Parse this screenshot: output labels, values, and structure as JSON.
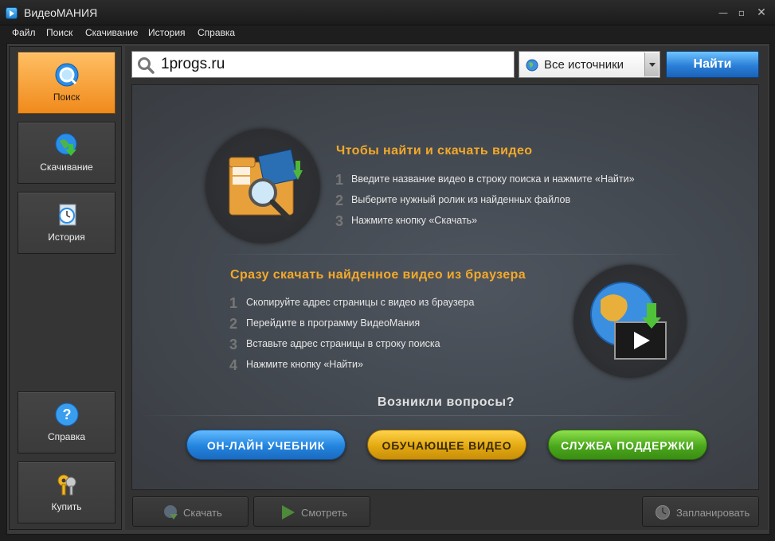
{
  "window": {
    "title": "ВидеоМАНИЯ"
  },
  "menu": [
    "Файл",
    "Поиск",
    "Скачивание",
    "История",
    "Справка"
  ],
  "sidebar": {
    "search": "Поиск",
    "download": "Скачивание",
    "history": "История",
    "help": "Справка",
    "buy": "Купить"
  },
  "search": {
    "value": "1progs.ru",
    "source": "Все источники",
    "button": "Найти"
  },
  "section1": {
    "title": "Чтобы найти и скачать видео",
    "steps": [
      "Введите название видео в строку поиска и нажмите «Найти»",
      "Выберите нужный ролик из найденных файлов",
      "Нажмите кнопку «Скачать»"
    ]
  },
  "section2": {
    "title": "Сразу скачать найденное видео из браузера",
    "steps": [
      "Скопируйте адрес страницы с видео из браузера",
      "Перейдите в программу ВидеоМания",
      "Вставьте адрес страницы в строку поиска",
      "Нажмите кнопку «Найти»"
    ]
  },
  "questions": {
    "title": "Возникли вопросы?",
    "online_tutorial": "ОН-ЛАЙН УЧЕБНИК",
    "training_video": "ОБУЧАЮЩЕЕ ВИДЕО",
    "support": "СЛУЖБА ПОДДЕРЖКИ"
  },
  "bottom": {
    "download": "Скачать",
    "watch": "Смотреть",
    "schedule": "Запланировать"
  },
  "colors": {
    "accent": "#f3a92b",
    "active_tab": "#f5a63a",
    "panel": "#444a52"
  }
}
